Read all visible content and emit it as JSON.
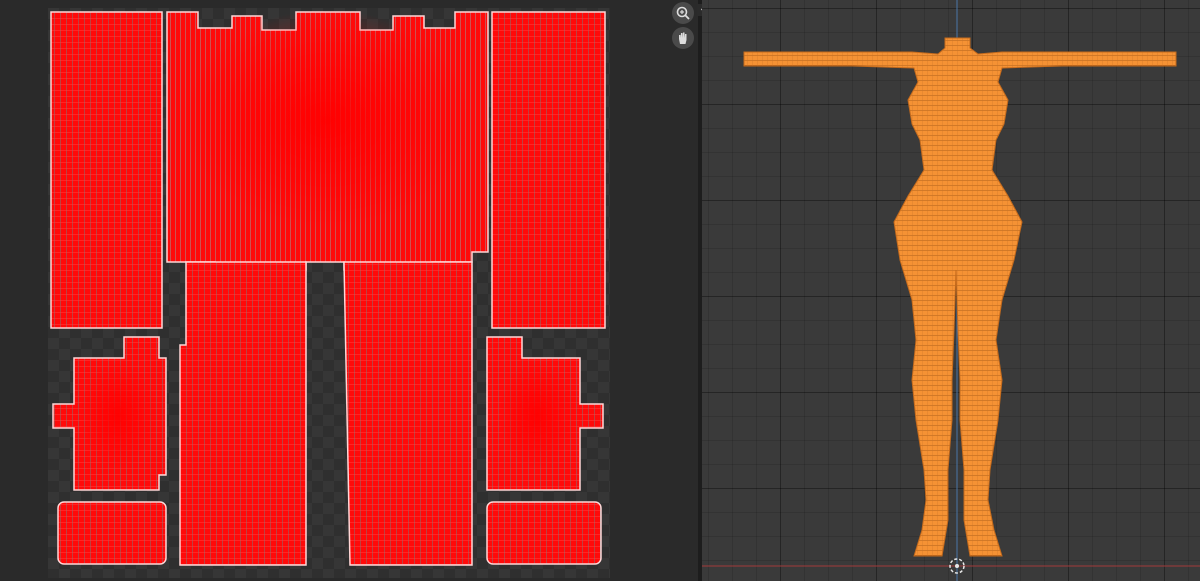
{
  "uv_editor": {
    "toolbar": {
      "zoom_icon": "magnify-plus-icon",
      "pan_icon": "hand-icon"
    },
    "colors": {
      "island_fill": "#ff0a0a",
      "island_outline": "#ffd4d4",
      "wire": "#6b6b6b",
      "checker_dark": "#2f2f2f",
      "checker_light": "#363636"
    }
  },
  "viewport_3d": {
    "colors": {
      "mesh": "#f28a25",
      "mesh_wire": "#a85812",
      "z_axis": "#4a77a8",
      "x_axis": "#a13a3a",
      "grid": "#3a3a3a"
    },
    "cursor_icon": "3d-cursor-icon"
  },
  "split_toggle_icon": "split-arrows-icon"
}
